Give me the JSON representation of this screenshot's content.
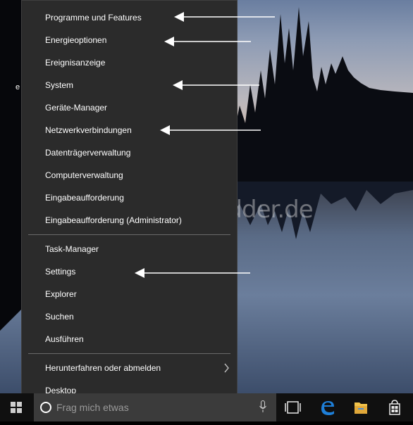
{
  "desktop": {
    "label": "e"
  },
  "menu": {
    "items": [
      {
        "label": "Programme und Features"
      },
      {
        "label": "Energieoptionen"
      },
      {
        "label": "Ereignisanzeige"
      },
      {
        "label": "System"
      },
      {
        "label": "Geräte-Manager"
      },
      {
        "label": "Netzwerkverbindungen"
      },
      {
        "label": "Datenträgerverwaltung"
      },
      {
        "label": "Computerverwaltung"
      },
      {
        "label": "Eingabeaufforderung"
      },
      {
        "label": "Eingabeaufforderung (Administrator)"
      },
      {
        "label": "Task-Manager"
      },
      {
        "label": "Settings"
      },
      {
        "label": "Explorer"
      },
      {
        "label": "Suchen"
      },
      {
        "label": "Ausführen"
      },
      {
        "label": "Herunterfahren oder abmelden",
        "submenu_icon": "chevron-right-icon"
      },
      {
        "label": "Desktop"
      }
    ]
  },
  "taskbar": {
    "start_icon": "windows-logo-icon",
    "search_placeholder": "Frag mich etwas",
    "search_icon": "cortana-icon",
    "mic_icon": "microphone-icon",
    "icons": [
      "task-view-icon",
      "edge-icon",
      "file-explorer-icon",
      "store-icon"
    ]
  },
  "watermark": "Deskmodder.de",
  "colors": {
    "menu_bg": "#2b2b2b",
    "taskbar_bg": "#101010",
    "search_bg": "#3b3b3b",
    "edge_blue": "#1e7fd8",
    "folder_yellow": "#f2c34a"
  }
}
